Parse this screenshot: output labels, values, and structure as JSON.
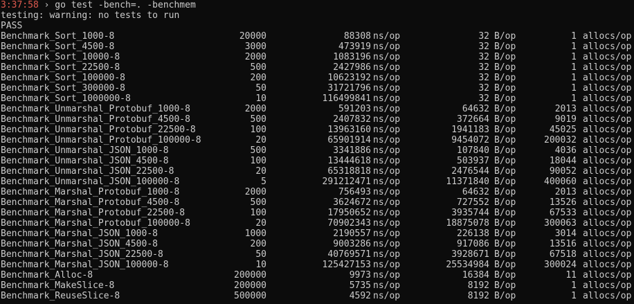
{
  "prompt": {
    "time": "3:37:58",
    "separator": "›",
    "command": "go test -bench=. -benchmem"
  },
  "output": {
    "warning": "testing: warning: no tests to run",
    "status": "PASS"
  },
  "units": {
    "ns": "ns/op",
    "bytes": "B/op",
    "allocs": "allocs/op"
  },
  "rows": [
    {
      "name": "Benchmark_Sort_1000-8",
      "iter": "20000",
      "ns": "88308",
      "bytes": "32",
      "allocs": "1"
    },
    {
      "name": "Benchmark_Sort_4500-8",
      "iter": "3000",
      "ns": "473919",
      "bytes": "32",
      "allocs": "1"
    },
    {
      "name": "Benchmark_Sort_10000-8",
      "iter": "2000",
      "ns": "1083196",
      "bytes": "32",
      "allocs": "1"
    },
    {
      "name": "Benchmark_Sort_22500-8",
      "iter": "500",
      "ns": "2427986",
      "bytes": "32",
      "allocs": "1"
    },
    {
      "name": "Benchmark_Sort_100000-8",
      "iter": "200",
      "ns": "10623192",
      "bytes": "32",
      "allocs": "1"
    },
    {
      "name": "Benchmark_Sort_300000-8",
      "iter": "50",
      "ns": "31721796",
      "bytes": "32",
      "allocs": "1"
    },
    {
      "name": "Benchmark_Sort_1000000-8",
      "iter": "10",
      "ns": "116499841",
      "bytes": "32",
      "allocs": "1"
    },
    {
      "name": "Benchmark_Unmarshal_Protobuf_1000-8",
      "iter": "2000",
      "ns": "591203",
      "bytes": "64632",
      "allocs": "2013"
    },
    {
      "name": "Benchmark_Unmarshal_Protobuf_4500-8",
      "iter": "500",
      "ns": "2407832",
      "bytes": "372664",
      "allocs": "9019"
    },
    {
      "name": "Benchmark_Unmarshal_Protobuf_22500-8",
      "iter": "100",
      "ns": "13963160",
      "bytes": "1941183",
      "allocs": "45025"
    },
    {
      "name": "Benchmark_Unmarshal_Protobuf_100000-8",
      "iter": "20",
      "ns": "65901914",
      "bytes": "9454072",
      "allocs": "200032"
    },
    {
      "name": "Benchmark_Unmarshal_JSON_1000-8",
      "iter": "500",
      "ns": "3341886",
      "bytes": "107840",
      "allocs": "4036"
    },
    {
      "name": "Benchmark_Unmarshal_JSON_4500-8",
      "iter": "100",
      "ns": "13444618",
      "bytes": "503937",
      "allocs": "18044"
    },
    {
      "name": "Benchmark_Unmarshal_JSON_22500-8",
      "iter": "20",
      "ns": "65318818",
      "bytes": "2476544",
      "allocs": "90052"
    },
    {
      "name": "Benchmark_Unmarshal_JSON_100000-8",
      "iter": "5",
      "ns": "291212471",
      "bytes": "11371840",
      "allocs": "400060"
    },
    {
      "name": "Benchmark_Marshal_Protobuf_1000-8",
      "iter": "2000",
      "ns": "756493",
      "bytes": "64632",
      "allocs": "2013"
    },
    {
      "name": "Benchmark_Marshal_Protobuf_4500-8",
      "iter": "500",
      "ns": "3624672",
      "bytes": "727552",
      "allocs": "13526"
    },
    {
      "name": "Benchmark_Marshal_Protobuf_22500-8",
      "iter": "100",
      "ns": "17950652",
      "bytes": "3935744",
      "allocs": "67533"
    },
    {
      "name": "Benchmark_Marshal_Protobuf_100000-8",
      "iter": "20",
      "ns": "70902343",
      "bytes": "18875078",
      "allocs": "300063"
    },
    {
      "name": "Benchmark_Marshal_JSON_1000-8",
      "iter": "1000",
      "ns": "2190557",
      "bytes": "226138",
      "allocs": "3014"
    },
    {
      "name": "Benchmark_Marshal_JSON_4500-8",
      "iter": "200",
      "ns": "9003286",
      "bytes": "917086",
      "allocs": "13516"
    },
    {
      "name": "Benchmark_Marshal_JSON_22500-8",
      "iter": "50",
      "ns": "40769571",
      "bytes": "3928671",
      "allocs": "67518"
    },
    {
      "name": "Benchmark_Marshal_JSON_100000-8",
      "iter": "10",
      "ns": "125427153",
      "bytes": "25534984",
      "allocs": "300024"
    },
    {
      "name": "Benchmark_Alloc-8",
      "iter": "200000",
      "ns": "9973",
      "bytes": "16384",
      "allocs": "11"
    },
    {
      "name": "Benchmark_MakeSlice-8",
      "iter": "200000",
      "ns": "5735",
      "bytes": "8192",
      "allocs": "1"
    },
    {
      "name": "Benchmark_ReuseSlice-8",
      "iter": "500000",
      "ns": "4592",
      "bytes": "8192",
      "allocs": "1"
    }
  ]
}
